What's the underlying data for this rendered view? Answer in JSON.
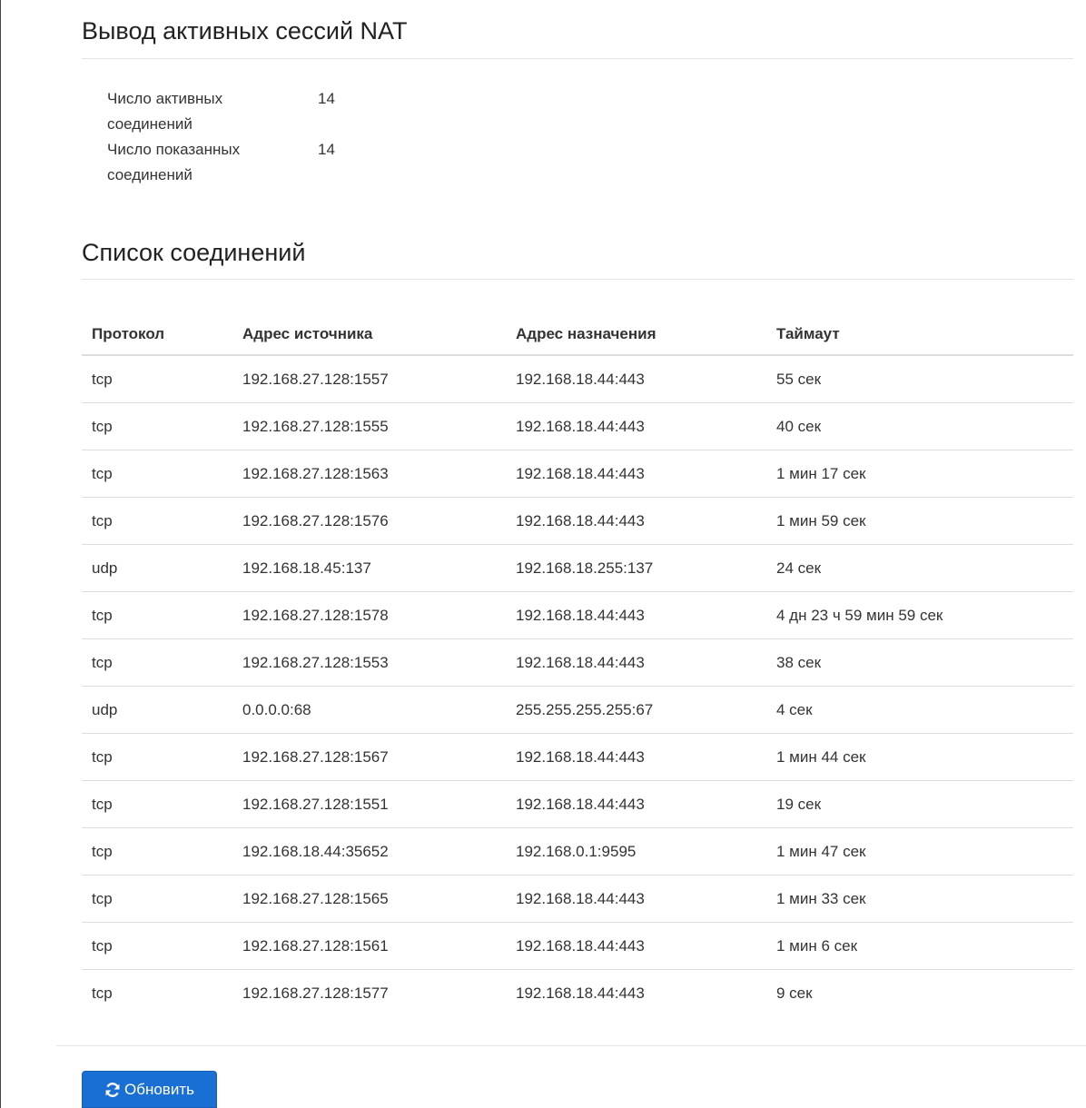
{
  "page": {
    "title": "Вывод активных сессий NAT"
  },
  "summary": {
    "rows": [
      {
        "label": "Число активных\nсоединений",
        "value": "14"
      },
      {
        "label": "Число показанных\nсоединений",
        "value": "14"
      }
    ]
  },
  "connections": {
    "title": "Список соединений",
    "headers": [
      "Протокол",
      "Адрес источника",
      "Адрес назначения",
      "Таймаут"
    ],
    "rows": [
      [
        "tcp",
        "192.168.27.128:1557",
        "192.168.18.44:443",
        "55 сек"
      ],
      [
        "tcp",
        "192.168.27.128:1555",
        "192.168.18.44:443",
        "40 сек"
      ],
      [
        "tcp",
        "192.168.27.128:1563",
        "192.168.18.44:443",
        "1 мин 17 сек"
      ],
      [
        "tcp",
        "192.168.27.128:1576",
        "192.168.18.44:443",
        "1 мин 59 сек"
      ],
      [
        "udp",
        "192.168.18.45:137",
        "192.168.18.255:137",
        "24 сек"
      ],
      [
        "tcp",
        "192.168.27.128:1578",
        "192.168.18.44:443",
        "4 дн 23 ч 59 мин 59 сек"
      ],
      [
        "tcp",
        "192.168.27.128:1553",
        "192.168.18.44:443",
        "38 сек"
      ],
      [
        "udp",
        "0.0.0.0:68",
        "255.255.255.255:67",
        "4 сек"
      ],
      [
        "tcp",
        "192.168.27.128:1567",
        "192.168.18.44:443",
        "1 мин 44 сек"
      ],
      [
        "tcp",
        "192.168.27.128:1551",
        "192.168.18.44:443",
        "19 сек"
      ],
      [
        "tcp",
        "192.168.18.44:35652",
        "192.168.0.1:9595",
        "1 мин 47 сек"
      ],
      [
        "tcp",
        "192.168.27.128:1565",
        "192.168.18.44:443",
        "1 мин 33 сек"
      ],
      [
        "tcp",
        "192.168.27.128:1561",
        "192.168.18.44:443",
        "1 мин 6 сек"
      ],
      [
        "tcp",
        "192.168.27.128:1577",
        "192.168.18.44:443",
        "9 сек"
      ]
    ]
  },
  "actions": {
    "refresh_label": "Обновить",
    "refresh_icon": "refresh-icon"
  },
  "colors": {
    "primary_button": "#1a6fd4",
    "divider": "#e5e5e5"
  }
}
